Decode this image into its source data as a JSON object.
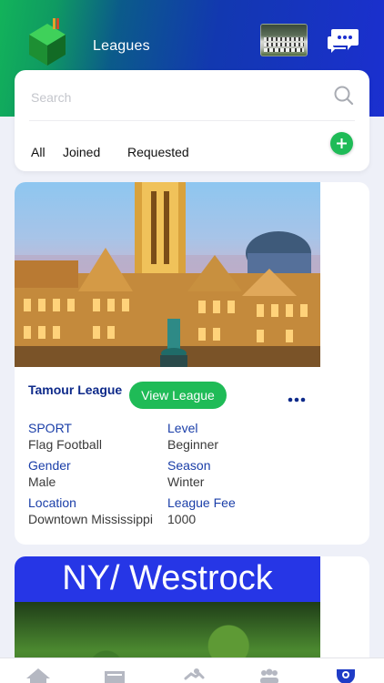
{
  "header": {
    "title": "Leagues"
  },
  "search": {
    "placeholder": "Search"
  },
  "filters": {
    "tabs": [
      "All",
      "Joined",
      "Requested"
    ]
  },
  "leagues": [
    {
      "name": "Tamour League",
      "view_label": "View League",
      "fields": {
        "sport_label": "SPORT",
        "sport_value": "Flag Football",
        "level_label": "Level",
        "level_value": "Beginner",
        "gender_label": "Gender",
        "gender_value": "Male",
        "season_label": "Season",
        "season_value": "Winter",
        "location_label": "Location",
        "location_value": "Downtown Mississippi",
        "fee_label": "League Fee",
        "fee_value": "1000"
      }
    },
    {
      "banner_text": "NY/ Westrock"
    }
  ],
  "icons": {
    "logo": "cube-logo",
    "team_photo": "team-photo",
    "chat": "chat-bubbles-icon",
    "search": "search-icon",
    "add": "plus-icon",
    "more": "more-dots-icon",
    "tabbar": [
      "home-icon",
      "news-icon",
      "activity-icon",
      "teams-icon",
      "league-badge-icon"
    ]
  },
  "colors": {
    "accent_green": "#1fbb57",
    "header_blue": "#1b2fd0",
    "label_blue": "#1a3ea8",
    "title_navy": "#0e2a8a"
  }
}
